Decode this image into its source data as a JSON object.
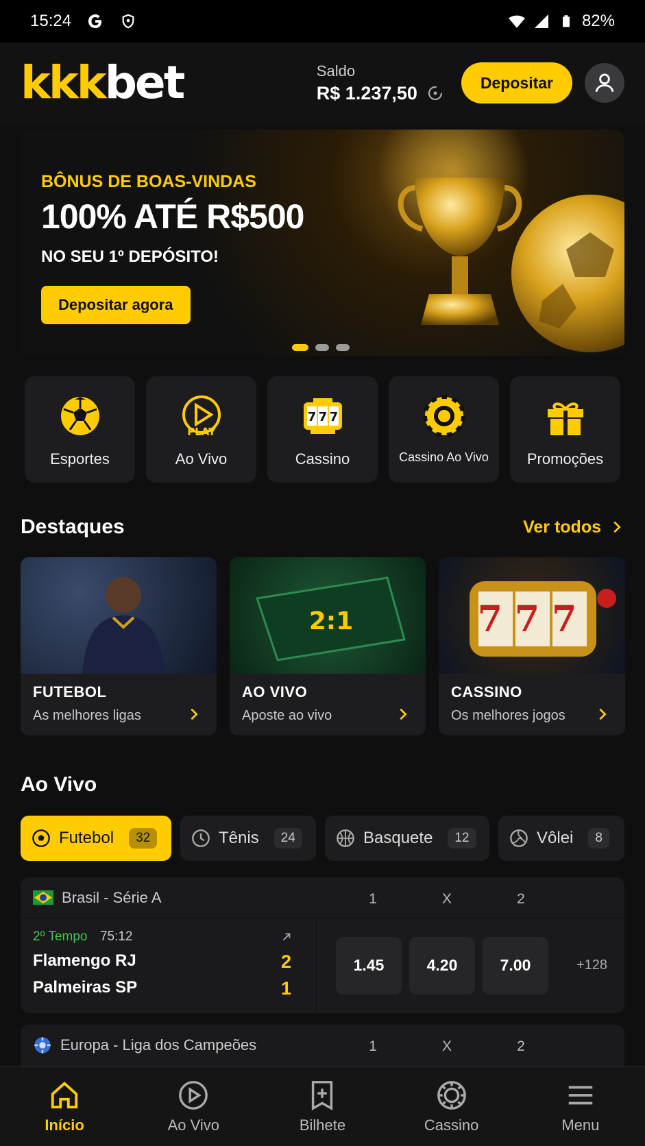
{
  "status_bar": {
    "time": "15:24",
    "battery": "82%"
  },
  "header": {
    "logo_part1": "kkk",
    "logo_part2": "bet",
    "balance_label": "Saldo",
    "balance_value": "R$ 1.237,50",
    "deposit_label": "Depositar"
  },
  "banner": {
    "subtitle": "BÔNUS DE BOAS-VINDAS",
    "title": "100% ATÉ R$500",
    "text": "NO SEU 1º DEPÓSITO!",
    "cta": "Depositar agora",
    "slide_count": 3,
    "active_slide": 1
  },
  "quick_menu": [
    {
      "label": "Esportes",
      "icon": "soccer-ball-icon"
    },
    {
      "label": "Ao Vivo",
      "icon": "play-live-icon"
    },
    {
      "label": "Cassino",
      "icon": "slot-777-icon"
    },
    {
      "label": "Cassino Ao Vivo",
      "icon": "casino-chip-icon"
    },
    {
      "label": "Promoções",
      "icon": "gift-icon"
    }
  ],
  "highlights": {
    "title": "Destaques",
    "see_all": "Ver todos",
    "cards": [
      {
        "title": "FUTEBOL",
        "subtitle": "As melhores ligas"
      },
      {
        "title": "AO VIVO",
        "subtitle": "Aposte ao vivo",
        "board_score": "2:1"
      },
      {
        "title": "CASSINO",
        "subtitle": "Os melhores jogos",
        "reels": "777"
      }
    ]
  },
  "live": {
    "title": "Ao Vivo",
    "tabs": [
      {
        "label": "Futebol",
        "count": "32",
        "icon": "soccer-ball-icon"
      },
      {
        "label": "Tênis",
        "count": "24",
        "icon": "clock-icon"
      },
      {
        "label": "Basquete",
        "count": "12",
        "icon": "basketball-icon"
      },
      {
        "label": "Vôlei",
        "count": "8",
        "icon": "volleyball-icon"
      }
    ],
    "odds_headers": [
      "1",
      "X",
      "2"
    ],
    "leagues": [
      {
        "name": "Brasil - Série A",
        "match": {
          "period": "2º Tempo",
          "clock": "75:12",
          "home": "Flamengo RJ",
          "away": "Palmeiras SP",
          "home_score": "2",
          "away_score": "1",
          "odds": [
            "1.45",
            "4.20",
            "7.00"
          ],
          "more": "+128"
        }
      },
      {
        "name": "Europa - Liga dos Campeões"
      }
    ]
  },
  "bottom_nav": [
    {
      "label": "Início",
      "icon": "home-icon"
    },
    {
      "label": "Ao Vivo",
      "icon": "live-play-icon"
    },
    {
      "label": "Bilhete",
      "icon": "bet-slip-icon"
    },
    {
      "label": "Cassino",
      "icon": "casino-chip-icon"
    },
    {
      "label": "Menu",
      "icon": "menu-icon"
    }
  ],
  "colors": {
    "accent": "#FFCC00",
    "background": "#0f0f10",
    "card": "#1d1d1f",
    "live_green": "#42c948"
  }
}
